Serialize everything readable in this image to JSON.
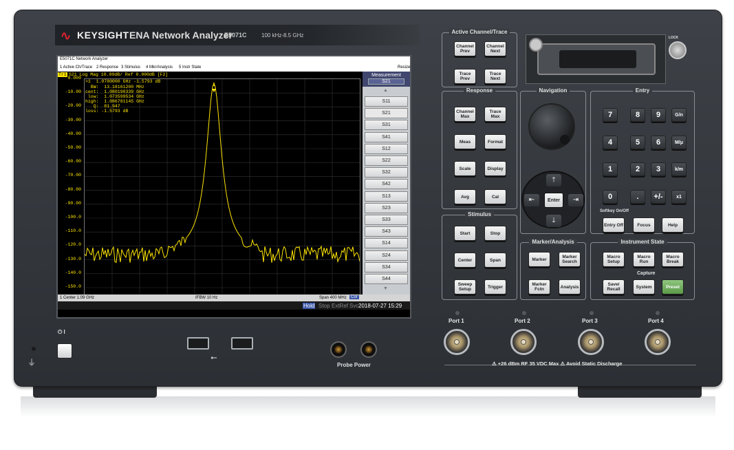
{
  "brand": {
    "logo": "KEYSIGHT",
    "model": "ENA Network Analyzer",
    "model_number": "E5071C",
    "freq_range": "100 kHz-8.5 GHz"
  },
  "window": {
    "title": "E5071C Network Analyzer",
    "resize_label": "Resize"
  },
  "menu": [
    "1 Active Ch/Trace",
    "2 Response",
    "3 Stimulus",
    "4 Mkr/Analysis",
    "5 Instr State"
  ],
  "trace": {
    "tr_label": "Tr1",
    "header": "S21 Log Mag 10.00dB/ Ref 0.000dB [F2]"
  },
  "marker": {
    "readout": ">1  1.0780000 GHz -1.5793 dB",
    "stats": "  BW:  13.18161200 MHz\ncent:  1.080190339 GHz\n low:  1.073599534 GHz\nhigh:  1.086781145 GHz\n   Q:  81.947\nloss: -1.5793 dB",
    "number": "1"
  },
  "y_ticks": [
    "0.000",
    "-10.00",
    "-20.00",
    "-30.00",
    "-40.00",
    "-50.00",
    "-60.00",
    "-70.00",
    "-80.00",
    "-90.00",
    "-100.0",
    "-110.0",
    "-120.0",
    "-130.0",
    "-140.0",
    "-150.0",
    "-160.0"
  ],
  "bottom": {
    "center": "1  Center 1.09 GHz",
    "ifbw": "IFBW 10 Hz",
    "span": "Span 400 MHz",
    "cor": "Cor"
  },
  "status": {
    "hold": "Hold",
    "stop": "Stop",
    "extref": "ExtRef",
    "svc": "Svc",
    "datetime": "2018-07-27 15:29"
  },
  "measurement": {
    "title": "Measurement",
    "current": "S21",
    "items": [
      "S11",
      "S21",
      "S31",
      "S41",
      "S12",
      "S22",
      "S32",
      "S42",
      "S13",
      "S23",
      "S33",
      "S43",
      "S14",
      "S24",
      "S34",
      "S44"
    ],
    "selected": "S21"
  },
  "panels": {
    "active_channel": {
      "title": "Active Channel/Trace",
      "keys": [
        "Channel Prev",
        "Channel Next",
        "Trace Prev",
        "Trace Next"
      ]
    },
    "response": {
      "title": "Response",
      "keys": [
        "Channel Max",
        "Trace Max",
        "Meas",
        "Format",
        "Scale",
        "Display",
        "Avg",
        "Cal"
      ]
    },
    "navigation": {
      "title": "Navigation",
      "enter": "Enter"
    },
    "entry": {
      "title": "Entry",
      "keys": [
        "7",
        "8",
        "9",
        "G/n",
        "4",
        "5",
        "6",
        "M/μ",
        "1",
        "2",
        "3",
        "k/m",
        "0",
        ".",
        "+/-",
        "x1"
      ],
      "softkey_label": "Softkey On/Off",
      "bottom_keys": [
        "Entry Off",
        "Focus",
        "Help"
      ]
    },
    "stimulus": {
      "title": "Stimulus",
      "keys": [
        "Start",
        "Stop",
        "Center",
        "Span",
        "Sweep Setup",
        "Trigger"
      ]
    },
    "marker_analysis": {
      "title": "Marker/Analysis",
      "keys": [
        "Marker",
        "Marker Search",
        "Marker Fctn",
        "Analysis"
      ]
    },
    "instrument_state": {
      "title": "Instrument State",
      "keys": [
        "Macro Setup",
        "Macro Run",
        "Macro Break",
        "Save/ Recall",
        "System",
        "Preset"
      ],
      "capture_label": "Capture"
    }
  },
  "lock_label": "LOCK",
  "ports": [
    "Port 1",
    "Port 2",
    "Port 3",
    "Port 4"
  ],
  "warning": "⚠ +26 dBm RF  35 VDC Max  ⚠ Avoid Static Discharge",
  "probe_power": "Probe Power",
  "power_symbol": "⏻ I",
  "colors": {
    "trace": "#ffe600",
    "preset": "#6aab56",
    "brand_red": "#e0212e"
  }
}
